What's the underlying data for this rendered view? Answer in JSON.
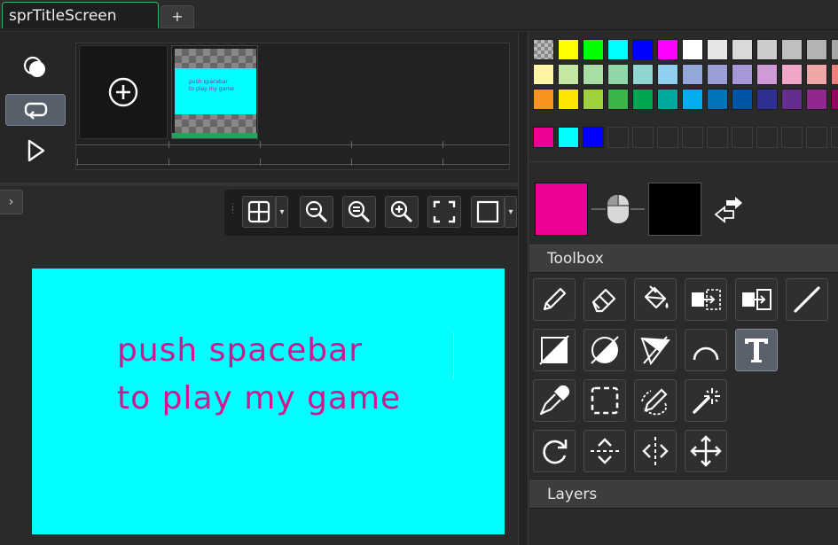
{
  "tabs": {
    "active_label": "sprTitleScreen",
    "add_label": "+"
  },
  "frames": {
    "thumb_text_line1": "push spacebar",
    "thumb_text_line2": "to play my game"
  },
  "canvas": {
    "text_line1": "push spacebar",
    "text_line2": "to play my game",
    "background_color": "#00ffff",
    "text_color": "#d1168f"
  },
  "collapse_label": "›",
  "colors": {
    "primary": "#ee0097",
    "secondary": "#000000",
    "accent_selected_frame": "#1fa55c",
    "tab_border": "#3cae6b"
  },
  "palette": {
    "row1": [
      "checker",
      "#ffff00",
      "#00ff00",
      "#00ffff",
      "#0000ff",
      "#ff00ff",
      "#ffffff",
      "#e6e6e6",
      "#d9d9d9",
      "#cccccc",
      "#bfbfbf",
      "#b3b3b3",
      "#a6a6a6"
    ],
    "row2": [
      "#fff4a3",
      "#c6e6a3",
      "#a6dea3",
      "#8fd6a8",
      "#8fd6d1",
      "#8fd0f0",
      "#93a8d9",
      "#9aa0d6",
      "#a897d6",
      "#d09ad6",
      "#f0a6c8",
      "#f0a6a6",
      "#f08080"
    ],
    "row3": [
      "#f7941d",
      "#ffe600",
      "#a0d13a",
      "#3ab54a",
      "#00a651",
      "#00a99d",
      "#00aeef",
      "#0072bc",
      "#0054a6",
      "#2e3192",
      "#662d91",
      "#92278f",
      "#9e005d"
    ],
    "custom": [
      "#ee0097",
      "#00ffff",
      "#0000ff",
      "empty",
      "empty",
      "empty",
      "empty",
      "empty",
      "empty",
      "empty",
      "empty",
      "empty",
      "empty"
    ]
  },
  "panels": {
    "toolbox_title": "Toolbox",
    "layers_title": "Layers"
  },
  "icons": {
    "play_modes": [
      "onion-skin-icon",
      "loop-icon",
      "play-icon"
    ],
    "canvas_toolbar": [
      "grid-icon",
      "zoom-out-icon",
      "zoom-reset-icon",
      "zoom-in-icon",
      "fit-screen-icon",
      "background-icon"
    ],
    "tools": [
      [
        "pencil-icon",
        "eraser-icon",
        "fill-bucket-icon",
        "copy-selection-icon",
        "paste-selection-icon",
        "line-icon"
      ],
      [
        "rectangle-icon",
        "ellipse-icon",
        "polygon-icon",
        "arc-icon",
        "text-icon"
      ],
      [
        "eyedropper-icon",
        "rectangle-select-icon",
        "lasso-select-icon",
        "magic-wand-icon"
      ],
      [
        "rotate-icon",
        "flip-vertical-icon",
        "flip-horizontal-icon",
        "move-icon"
      ]
    ]
  }
}
